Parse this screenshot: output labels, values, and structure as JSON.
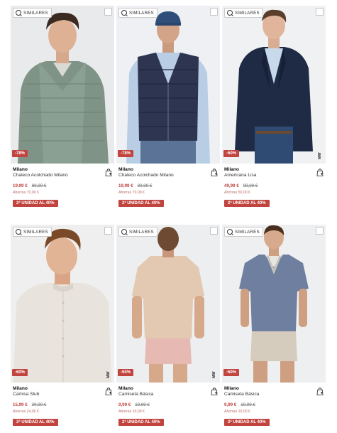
{
  "similares_label": "SIMILARES",
  "promo_label": "2ª UNIDAD AL 40%",
  "brand_mark": "MW",
  "accent_color": "#c1443f",
  "products": [
    {
      "discount": "-78%",
      "brand": "Milano",
      "name": "Chaleco Acolchado Milano",
      "price": "19,99 €",
      "old_price": "89,99 €",
      "saving": "Ahorras 70,00 €",
      "image": "man-in-green-quilted-vest"
    },
    {
      "discount": "-78%",
      "brand": "Milano",
      "name": "Chaleco Acolchado Milano",
      "price": "19,99 €",
      "old_price": "89,99 €",
      "saving": "Ahorras 70,00 €",
      "image": "man-in-navy-quilted-vest-with-cap"
    },
    {
      "discount": "-50%",
      "brand": "Milano",
      "name": "Americana Lisa",
      "price": "49,99 €",
      "old_price": "99,99 €",
      "saving": "Ahorras 50,00 €",
      "image": "man-in-navy-blazer"
    },
    {
      "discount": "-60%",
      "brand": "Milano",
      "name": "Camisa Slub",
      "price": "15,99 €",
      "old_price": "39,99 €",
      "saving": "Ahorras 24,00 €",
      "image": "man-in-linen-mandarin-shirt"
    },
    {
      "discount": "-50%",
      "brand": "Milano",
      "name": "Camiseta Básica",
      "price": "9,99 €",
      "old_price": "19,99 €",
      "saving": "Ahorras 10,00 €",
      "image": "man-in-beige-tshirt-back-view"
    },
    {
      "discount": "-50%",
      "brand": "Milano",
      "name": "Camiseta Básica",
      "price": "9,99 €",
      "old_price": "19,99 €",
      "saving": "Ahorras 10,00 €",
      "image": "man-in-blue-polo"
    }
  ]
}
